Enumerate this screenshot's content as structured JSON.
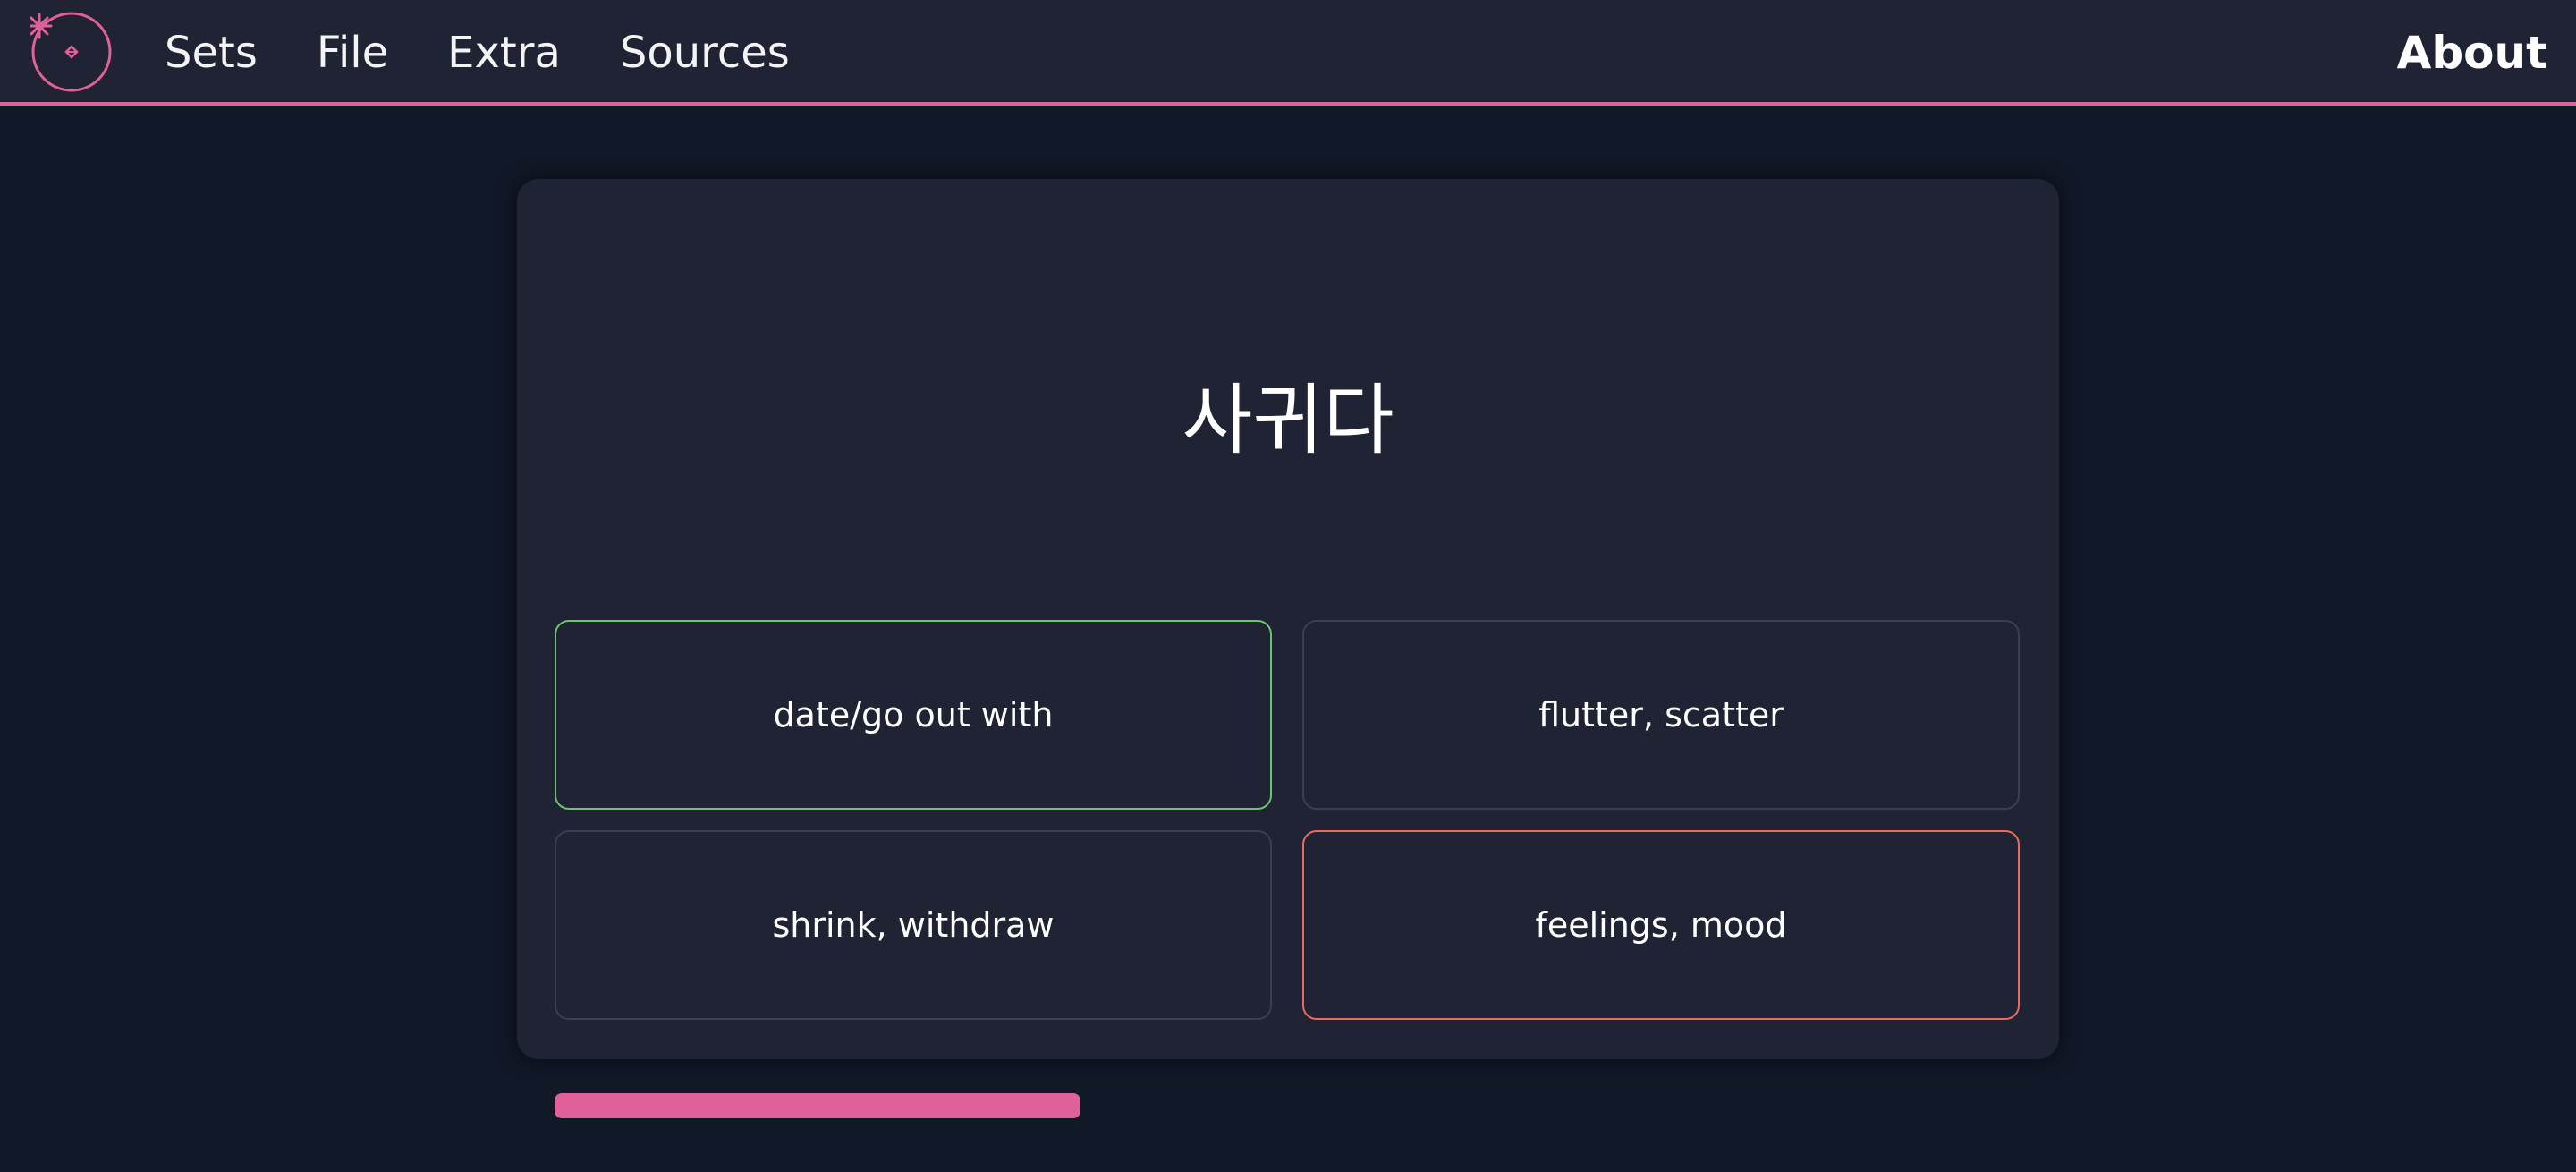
{
  "nav": {
    "items": [
      {
        "label": "Sets"
      },
      {
        "label": "File"
      },
      {
        "label": "Extra"
      },
      {
        "label": "Sources"
      }
    ],
    "about_label": "About"
  },
  "quiz": {
    "prompt": "사귀다",
    "options": [
      {
        "label": "date/go out with",
        "state": "correct"
      },
      {
        "label": "flutter, scatter",
        "state": "neutral"
      },
      {
        "label": "shrink, withdraw",
        "state": "neutral"
      },
      {
        "label": "feelings, mood",
        "state": "wrong"
      }
    ],
    "progress": 0.34
  },
  "colors": {
    "accent": "#e0609a",
    "correct": "#6cc56a",
    "wrong": "#e76b60",
    "background": "#111827",
    "surface": "#1f2333"
  },
  "icons": {
    "logo": "sparkle-circle-logo-icon"
  }
}
